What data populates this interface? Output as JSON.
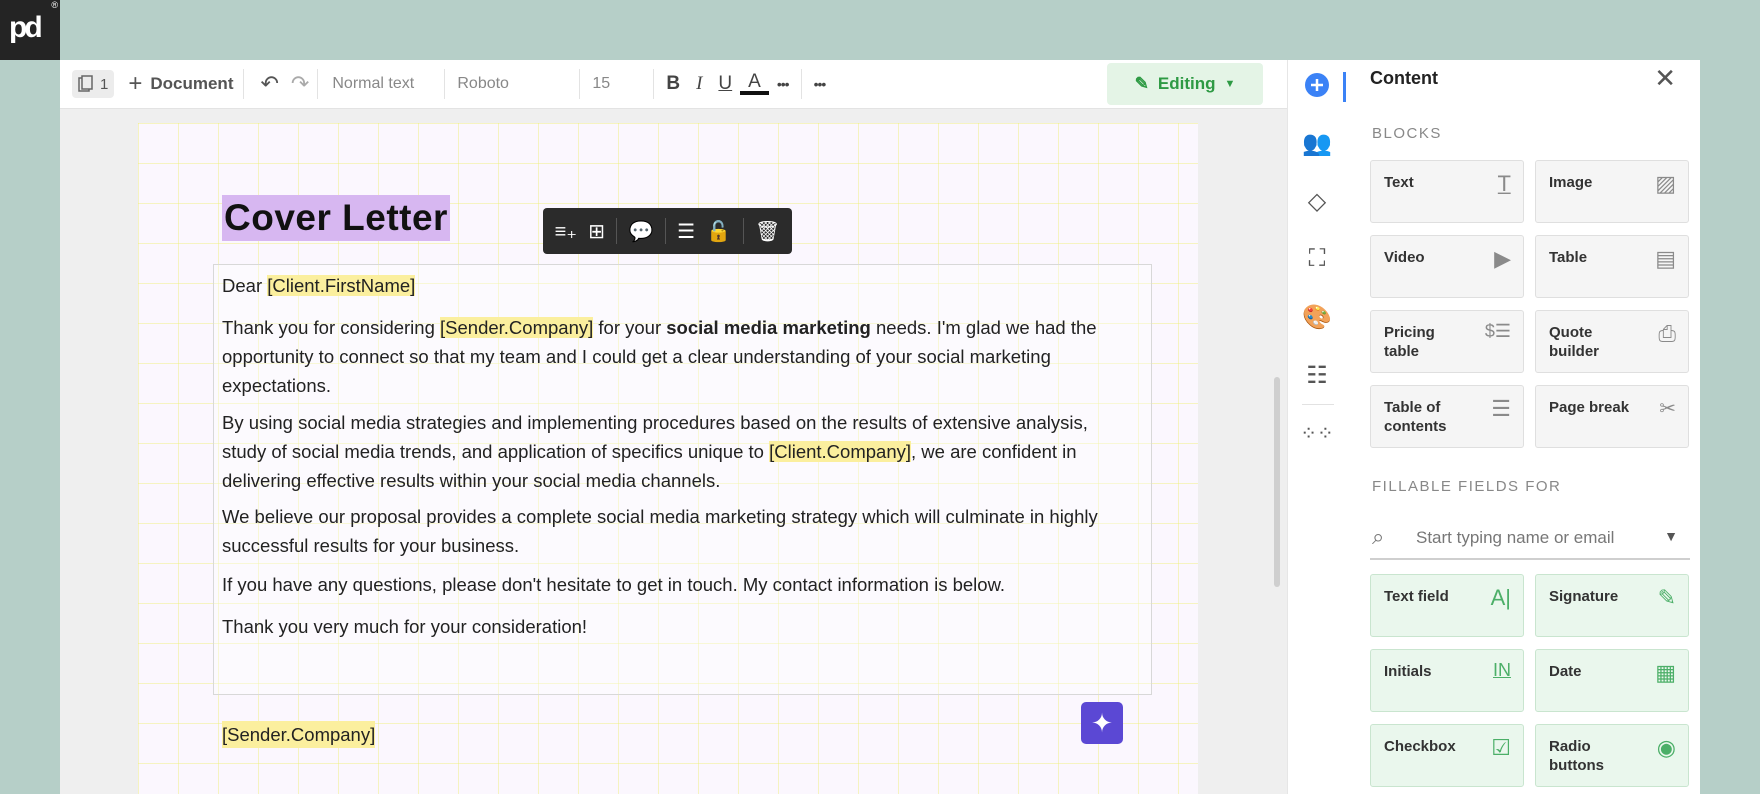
{
  "brand": {
    "logo_text": "pd",
    "reg_mark": "®"
  },
  "toolbar": {
    "page_count": "1",
    "add_document_label": "Document",
    "style_value": "Normal text",
    "font_value": "Roboto",
    "size_value": "15",
    "bold_label": "B",
    "italic_label": "I",
    "underline_label": "U",
    "text_color_label": "A",
    "more_label": "•••",
    "more2_label": "•••",
    "mode_label": "Editing"
  },
  "document": {
    "title": "Cover Letter",
    "greeting_prefix": "Dear ",
    "greeting_var": "[Client.FirstName]",
    "p1_a": "Thank you for considering ",
    "p1_var": "[Sender.Company]",
    "p1_b": " for your ",
    "p1_bold": "social media marketing",
    "p1_c": " needs. I'm glad we had the opportunity to connect so that my team and I could get a clear understanding of your social marketing expectations.",
    "p2_a": "By using social media strategies and implementing procedures based on the results of extensive analysis, study of social media trends, and application of specifics unique to ",
    "p2_var": "[Client.Company]",
    "p2_b": ", we are confident in delivering effective results within your social media channels.",
    "p3": "We believe our proposal provides a complete social media marketing strategy which will culminate in highly successful results for your business.",
    "p4": "If you have any questions, please don't hesitate to get in touch. My contact information is below.",
    "p5": "Thank you very much for your consideration!",
    "sender_var": "[Sender.Company]"
  },
  "panel": {
    "title": "Content",
    "blocks_label": "BLOCKS",
    "blocks": [
      {
        "label": "Text",
        "icon": "text-icon"
      },
      {
        "label": "Image",
        "icon": "image-icon"
      },
      {
        "label": "Video",
        "icon": "video-icon"
      },
      {
        "label": "Table",
        "icon": "table-icon"
      },
      {
        "label": "Pricing table",
        "icon": "pricing-table-icon"
      },
      {
        "label": "Quote builder",
        "icon": "quote-builder-icon"
      },
      {
        "label": "Table of contents",
        "icon": "toc-icon"
      },
      {
        "label": "Page break",
        "icon": "page-break-icon"
      }
    ],
    "fillable_label": "FILLABLE FIELDS FOR",
    "search_placeholder": "Start typing name or email",
    "fields": [
      {
        "label": "Text field",
        "icon": "text-field-icon"
      },
      {
        "label": "Signature",
        "icon": "signature-icon"
      },
      {
        "label": "Initials",
        "icon": "initials-icon"
      },
      {
        "label": "Date",
        "icon": "calendar-icon"
      },
      {
        "label": "Checkbox",
        "icon": "checkbox-icon"
      },
      {
        "label": "Radio buttons",
        "icon": "radio-icon"
      }
    ]
  },
  "colors": {
    "accent": "#3b82f6",
    "editing": "#2e9a44",
    "title_highlight": "#d7b7f1",
    "variable_highlight": "#fbef9e",
    "ai_button": "#5b48d4"
  }
}
